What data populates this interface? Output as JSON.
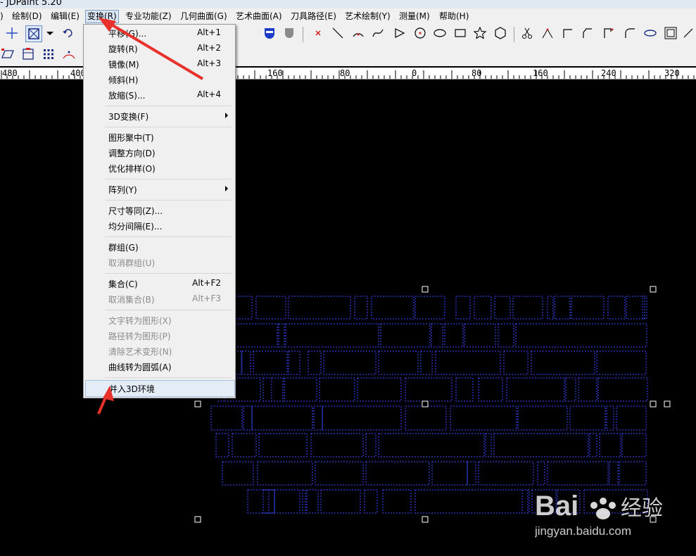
{
  "app": {
    "title": "- JDPaint 5.20"
  },
  "menubar": {
    "items": [
      {
        "id": "left",
        "label": ")"
      },
      {
        "id": "draw",
        "label": "绘制(D)"
      },
      {
        "id": "edit",
        "label": "编辑(E)"
      },
      {
        "id": "transform",
        "label": "变换(R)"
      },
      {
        "id": "special",
        "label": "专业功能(Z)"
      },
      {
        "id": "geosurf",
        "label": "几何曲面(G)"
      },
      {
        "id": "artsurf",
        "label": "艺术曲面(A)"
      },
      {
        "id": "toolpath",
        "label": "刀具路径(E)"
      },
      {
        "id": "artdraw",
        "label": "艺术绘制(Y)"
      },
      {
        "id": "measure",
        "label": "测量(M)"
      },
      {
        "id": "help",
        "label": "帮助(H)"
      }
    ]
  },
  "ruler": {
    "labels": [
      "480",
      "400",
      "160",
      "80",
      "0",
      "80",
      "160",
      "240",
      "320"
    ]
  },
  "transform_menu": {
    "items": [
      {
        "label": "平移(G)...",
        "shortcut": "Alt+1",
        "disabled": false
      },
      {
        "label": "旋转(R)",
        "shortcut": "Alt+2",
        "disabled": false
      },
      {
        "label": "镜像(M)",
        "shortcut": "Alt+3",
        "disabled": false
      },
      {
        "label": "倾斜(H)",
        "shortcut": "",
        "disabled": false
      },
      {
        "label": "放缩(S)...",
        "shortcut": "Alt+4",
        "disabled": false
      },
      {
        "label": "3D变换(F)",
        "shortcut": "",
        "submenu": true
      },
      {
        "label": "图形聚中(T)",
        "shortcut": ""
      },
      {
        "label": "调整方向(D)",
        "shortcut": ""
      },
      {
        "label": "优化排样(O)",
        "shortcut": ""
      },
      {
        "label": "阵列(Y)",
        "shortcut": "",
        "submenu": true
      },
      {
        "label": "尺寸等同(Z)...",
        "shortcut": ""
      },
      {
        "label": "均分间隔(E)...",
        "shortcut": ""
      },
      {
        "label": "群组(G)",
        "shortcut": ""
      },
      {
        "label": "取消群组(U)",
        "shortcut": "",
        "disabled": true
      },
      {
        "label": "集合(C)",
        "shortcut": "Alt+F2"
      },
      {
        "label": "取消集合(B)",
        "shortcut": "Alt+F3",
        "disabled": true
      },
      {
        "label": "文字转为图形(X)",
        "shortcut": "",
        "disabled": true
      },
      {
        "label": "路径转为图形(P)",
        "shortcut": "",
        "disabled": true
      },
      {
        "label": "清除艺术变形(N)",
        "shortcut": "",
        "disabled": true
      },
      {
        "label": "曲线转为圆弧(A)",
        "shortcut": ""
      },
      {
        "label": "并入3D环境",
        "shortcut": "",
        "highlighted": true
      }
    ]
  },
  "watermark": {
    "brand_a": "Bai",
    "brand_b": "经验",
    "url": "jingyan.baidu.com"
  },
  "colors": {
    "selection_dash": "#3a4cff",
    "annotation_arrow": "#e8312b"
  }
}
